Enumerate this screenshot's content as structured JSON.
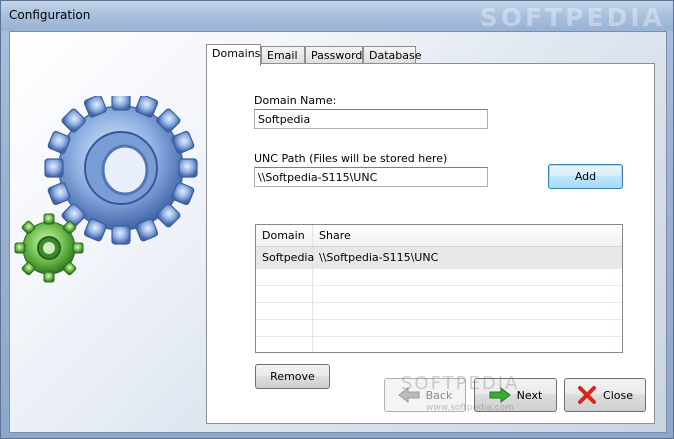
{
  "window": {
    "title": "Configuration",
    "watermark": "SOFTPEDIA"
  },
  "tabs": [
    {
      "label": "Domains",
      "active": true
    },
    {
      "label": "Email",
      "active": false
    },
    {
      "label": "Password",
      "active": false
    },
    {
      "label": "Database",
      "active": false
    }
  ],
  "form": {
    "domain_name_label": "Domain Name:",
    "domain_name_value": "Softpedia",
    "unc_label": "UNC Path (Files will be stored here)",
    "unc_value": "\\\\Softpedia-S115\\UNC",
    "add_label": "Add"
  },
  "table": {
    "columns": [
      "Domain",
      "Share"
    ],
    "rows": [
      {
        "domain": "Softpedia",
        "share": "\\\\Softpedia-S115\\UNC"
      }
    ]
  },
  "buttons": {
    "remove": "Remove",
    "back": "Back",
    "next": "Next",
    "close": "Close"
  },
  "overlay": {
    "brand": "SOFTPEDIA",
    "site": "www.softpedia.com"
  },
  "colors": {
    "next_arrow": "#2e9b2e",
    "close_x": "#d8281c",
    "gear_blue": "#5f86c8",
    "gear_green": "#4fa63a"
  }
}
